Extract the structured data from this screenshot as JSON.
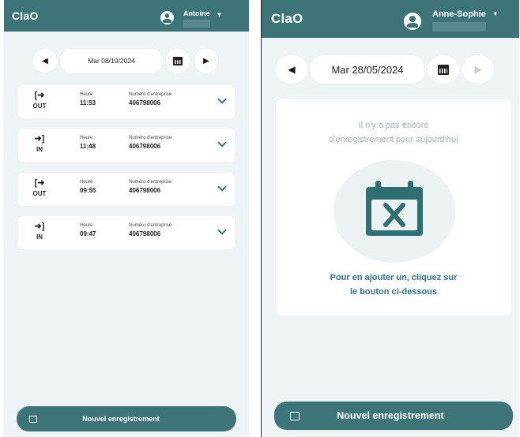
{
  "left": {
    "app_title": "ClaO",
    "user_name": "Antoine",
    "date": "Mar 08/10/2024",
    "entries": [
      {
        "direction": "OUT",
        "time_label": "Heure",
        "time": "11:53",
        "company_label": "Numéro d'entreprise",
        "company": "406798006"
      },
      {
        "direction": "IN",
        "time_label": "Heure",
        "time": "11:48",
        "company_label": "Numéro d'entreprise",
        "company": "406798006"
      },
      {
        "direction": "OUT",
        "time_label": "Heure",
        "time": "09:55",
        "company_label": "Numéro d'entreprise",
        "company": "406798006"
      },
      {
        "direction": "IN",
        "time_label": "Heure",
        "time": "09:47",
        "company_label": "Numéro d'entreprise",
        "company": "406798006"
      }
    ],
    "new_button": "Nouvel enregistrement"
  },
  "right": {
    "app_title": "ClaO",
    "user_name": "Anne-Sophie",
    "date": "Mar 28/05/2024",
    "empty_line1": "Il n'y a pas encore",
    "empty_line2": "d'enregistrement pour aujourd'hui",
    "add_line1": "Pour en ajouter un, cliquez sur",
    "add_line2": "le bouton ci-dessous",
    "new_button": "Nouvel enregistrement"
  },
  "icons": {
    "user": "user-avatar-icon",
    "caret": "caret-down-icon",
    "prev": "triangle-left-icon",
    "next": "triangle-right-icon",
    "calendar": "calendar-icon",
    "sign_out": "sign-out-icon",
    "sign_in": "sign-in-icon",
    "chevron": "chevron-down-icon",
    "empty_calendar": "calendar-x-icon"
  },
  "colors": {
    "header": "#3c7478",
    "background": "#eef3f6",
    "accent_text": "#2f6f88",
    "muted_text": "#a7b4b8"
  }
}
